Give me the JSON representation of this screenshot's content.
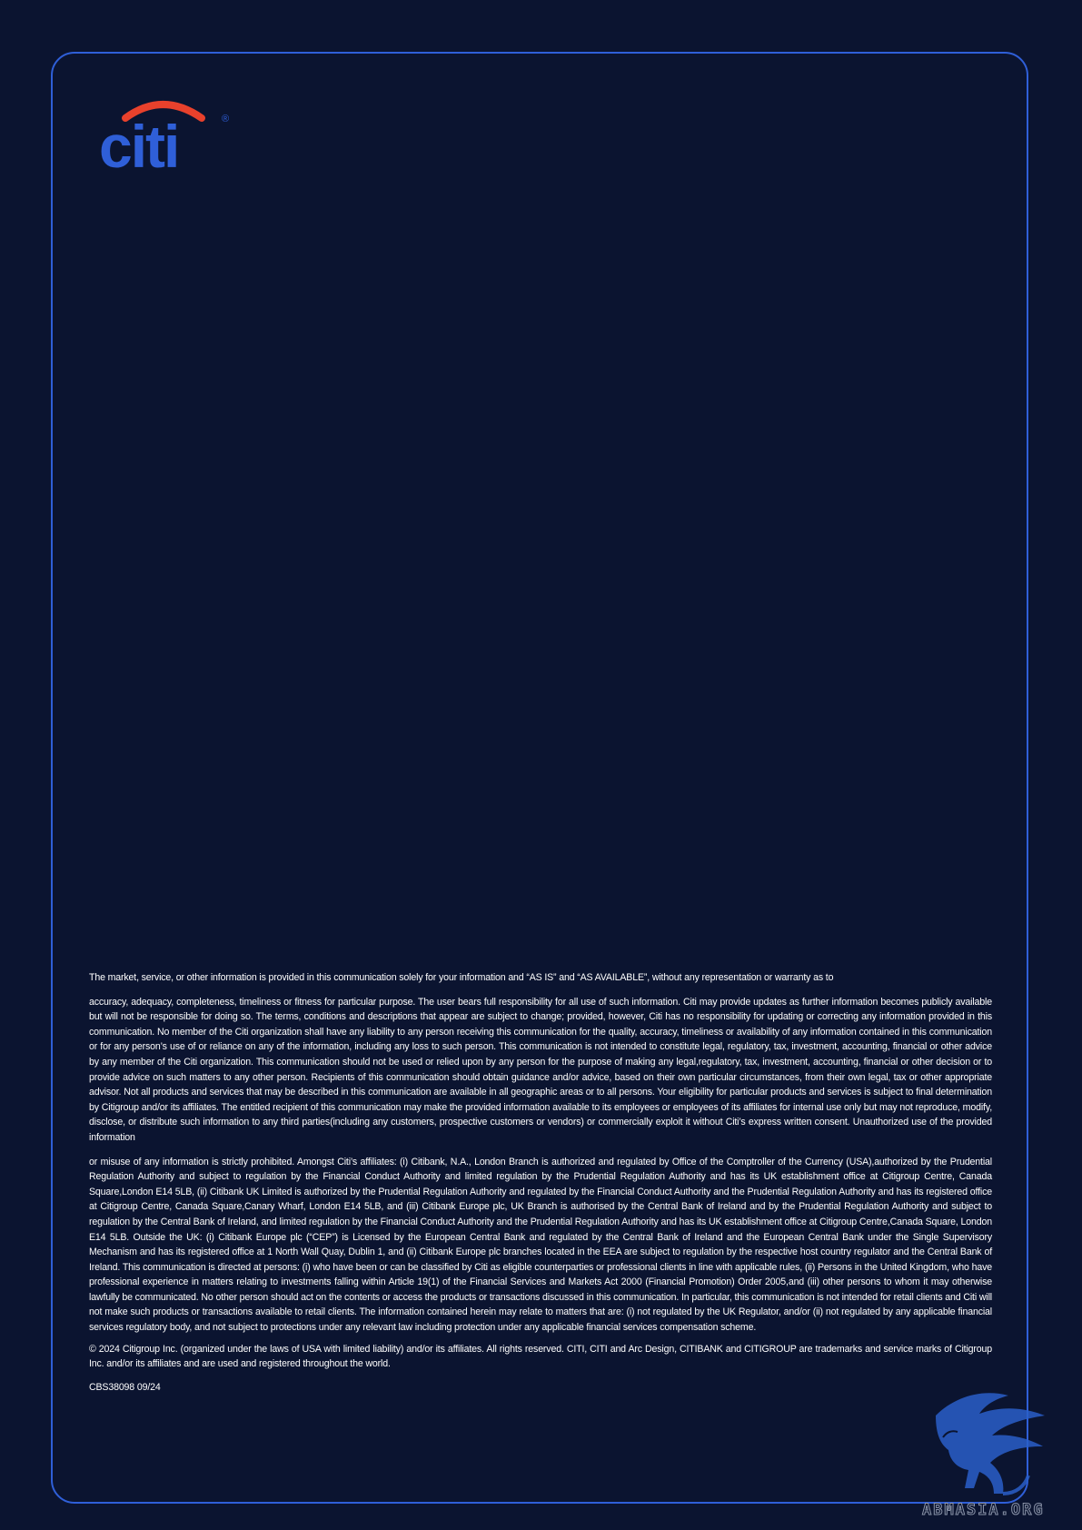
{
  "logo": {
    "wordmark": "citi",
    "registered_mark": "®",
    "arc_color": "#e8412c",
    "text_color": "#2f5fd8"
  },
  "colors": {
    "background": "#0b1430",
    "frame_border": "#2f5fd8",
    "text": "#ffffff"
  },
  "disclaimer": {
    "p1": "The market, service, or other information is provided in this communication solely for your information and “AS IS” and “AS AVAILABLE”, without any representation or warranty as to",
    "p2": "accuracy, adequacy, completeness, timeliness or fitness for particular purpose. The user bears full responsibility for all use of such information. Citi may provide updates as further information becomes publicly available but will not be responsible for doing so. The terms, conditions and descriptions that appear are subject to change; provided, however, Citi has no responsibility for updating or correcting any information provided in this communication. No member of the Citi organization shall have any liability to any person receiving this communication for the quality, accuracy, timeliness or availability of any information contained in this communication or for any person’s use of or reliance on any of the information, including any loss to such person. This communication is not intended to constitute legal, regulatory, tax, investment, accounting, financial or other advice by any member of the Citi organization. This communication should not be used or relied upon by any person for the purpose of making any legal,regulatory, tax, investment, accounting, financial or other decision or to provide advice on such matters to any other person. Recipients of this communication should obtain guidance and/or advice, based on their own particular circumstances, from their own legal, tax or other appropriate advisor. Not all products and services that may be described in this communication are available in all geographic areas or to all persons. Your eligibility for particular products and services is subject to final determination by Citigroup and/or its affiliates. The entitled recipient of this communication may make the provided information available to its employees or employees of its affiliates for internal use only but may not reproduce, modify, disclose, or distribute such information to any third parties(including any customers, prospective customers or vendors) or commercially exploit it without Citi’s express written consent. Unauthorized use of the provided information",
    "p3": "or misuse of any information is strictly prohibited. Amongst Citi’s affiliates: (i) Citibank, N.A., London Branch is authorized and regulated by Office of the Comptroller of the Currency (USA),authorized by the Prudential Regulation Authority and subject to regulation by the Financial Conduct Authority and limited regulation by the Prudential Regulation Authority and has its UK establishment office at Citigroup Centre, Canada Square,London E14 5LB, (ii) Citibank UK Limited is authorized by the Prudential Regulation Authority and regulated by the Financial Conduct Authority and the Prudential Regulation Authority and has its registered office at Citigroup Centre, Canada Square,Canary Wharf, London E14 5LB, and (iii) Citibank Europe plc, UK Branch is authorised by the Central Bank of Ireland and by the Prudential Regulation Authority and subject to regulation by the Central Bank of Ireland, and limited regulation by the Financial Conduct Authority and the Prudential Regulation Authority and has its UK establishment office at Citigroup Centre,Canada Square, London E14 5LB. Outside the UK: (i) Citibank Europe plc (“CEP”) is Licensed by the European Central Bank and regulated by the Central Bank of Ireland and the European Central Bank under the Single Supervisory Mechanism and has its registered office at 1 North Wall Quay, Dublin 1, and (ii) Citibank Europe plc branches located in the EEA are subject to regulation by the respective host country regulator and the Central Bank of Ireland. This communication is directed at persons: (i) who have been or can be classified by Citi as eligible counterparties or professional clients in line with applicable rules, (ii) Persons in the United Kingdom, who have professional experience in matters relating to investments falling within Article 19(1) of the Financial Services and Markets Act 2000 (Financial Promotion) Order 2005,and (iii) other persons to whom it may otherwise lawfully be communicated. No other person should act on the contents or access the products or transactions discussed in this communication. In particular, this communication is not intended for retail clients and Citi will not make such products or transactions available to retail clients. The information contained herein may relate to matters that are: (i) not regulated by the UK Regulator, and/or (ii) not regulated by any applicable financial services regulatory body, and not subject to protections under any relevant law including protection under any applicable financial services compensation scheme.",
    "p4": "© 2024 Citigroup Inc. (organized under the laws of USA with limited liability) and/or its affiliates. All rights reserved. CITI, CITI and Arc Design, CITIBANK and CITIGROUP are trademarks and service marks of Citigroup Inc. and/or its affiliates and are used and registered throughout the world.",
    "code": "CBS38098 09/24"
  },
  "watermark": {
    "text": "ABMASIA.ORG",
    "icon": "griffin-watermark-icon",
    "color": "#2a5fc9"
  }
}
